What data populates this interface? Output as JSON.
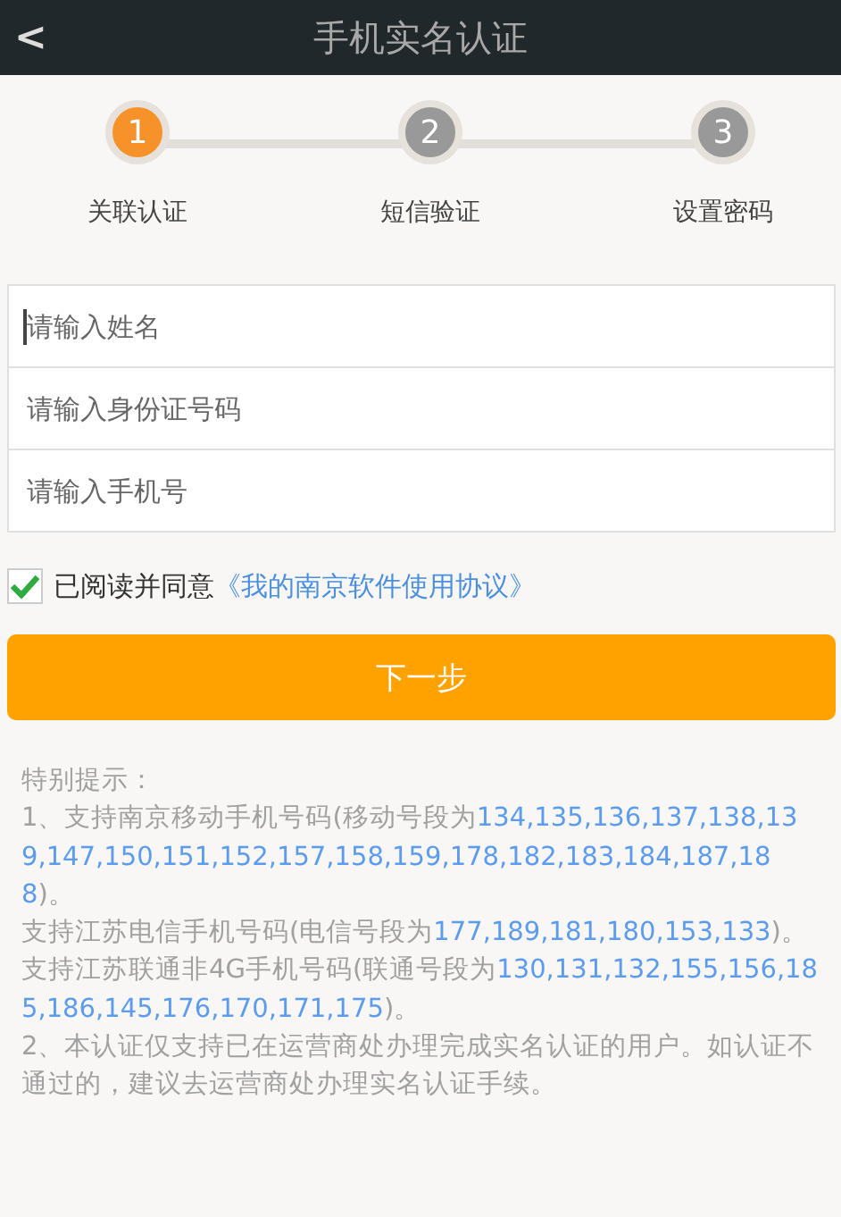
{
  "header": {
    "back": "<",
    "title": "手机实名认证"
  },
  "steps": [
    {
      "number": "1",
      "label": "关联认证",
      "selected": true
    },
    {
      "number": "2",
      "label": "短信验证",
      "selected": false
    },
    {
      "number": "3",
      "label": "设置密码",
      "selected": false
    }
  ],
  "fields": [
    {
      "placeholder": "请输入姓名",
      "focused": true
    },
    {
      "placeholder": "请输入身份证号码",
      "focused": false
    },
    {
      "placeholder": "请输入手机号",
      "focused": false
    }
  ],
  "agreement": {
    "checked": true,
    "text": "已阅读并同意",
    "link": "《我的南京软件使用协议》"
  },
  "next_button": "下一步",
  "notice": {
    "heading": "特别提示：",
    "items": [
      {
        "before": "1、支持南京移动手机号码(移动号段为",
        "numbers": "134,135,136,137,138,139,147,150,151,152,157,158,159,178,182,183,184,187,188",
        "after": ")。"
      },
      {
        "before": "支持江苏电信手机号码(电信号段为",
        "numbers": "177,189,181,180,153,133",
        "after": ")。"
      },
      {
        "before": "支持江苏联通非4G手机号码(联通号段为",
        "numbers": "130,131,132,155,156,185,186,145,176,170,171,175",
        "after": ")。"
      },
      {
        "before": "2、本认证仅支持已在运营商处办理完成实名认证的用户。如认证不通过的，建议去运营商处办理实名认证手续。"
      }
    ]
  }
}
